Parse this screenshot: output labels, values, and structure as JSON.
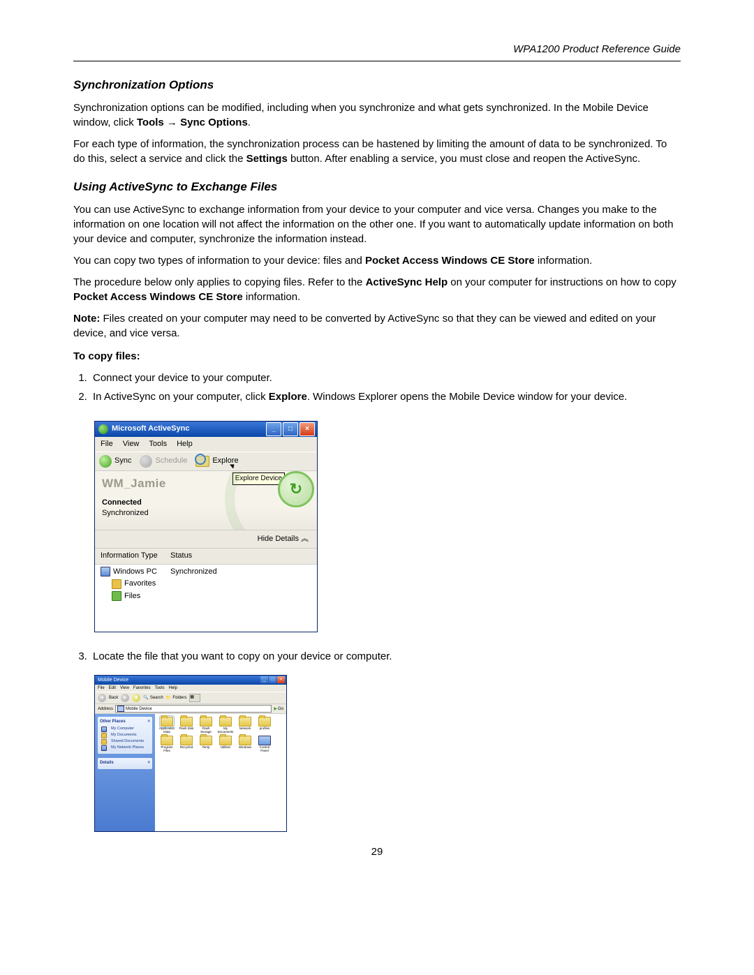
{
  "header": {
    "guide_title": "WPA1200 Product Reference Guide"
  },
  "section1": {
    "heading": "Synchronization Options",
    "para1_a": "Synchronization options can be modified, including when you synchronize and what gets synchronized. In the Mobile Device window, click ",
    "tools_bold": "Tools",
    "arrow": " → ",
    "sync_options_bold": "Sync Options",
    "para1_end": ".",
    "para2_a": "For each type of information, the synchronization process can be hastened by limiting the amount of data to be synchronized. To do this, select a service and click the ",
    "settings_bold": "Settings",
    "para2_b": " button. After enabling a service, you must close and reopen the ActiveSync."
  },
  "section2": {
    "heading": "Using ActiveSync to Exchange Files",
    "para1": "You can use ActiveSync to exchange information from your device to your computer and vice versa. Changes you make to the information on one location will not affect the information on the other one. If you want to automatically update information on both your device and computer, synchronize the information instead.",
    "para2_a": "You can copy two types of information to your device: files and ",
    "pocket_bold": "Pocket Access Windows CE Store",
    "para2_b": " information.",
    "para3_a": "The procedure below only applies to copying files. Refer to the ",
    "ashelp_bold": "ActiveSync Help",
    "para3_b": " on your computer for instructions on how to copy ",
    "pocket_bold2": "Pocket Access Windows CE Store",
    "para3_c": " information.",
    "note_label": "Note:",
    "note_text": " Files created on your computer may need to be converted by ActiveSync so that they can be viewed and edited on your device, and vice versa.",
    "to_copy": "To copy files:",
    "step1": "Connect your device to your computer.",
    "step2_a": "In ActiveSync on your computer, click ",
    "step2_bold": "Explore",
    "step2_b": ". Windows Explorer opens the Mobile Device window for your device.",
    "step3": "Locate the file that you want to copy on your device or computer."
  },
  "activesync": {
    "title": "Microsoft ActiveSync",
    "menu": {
      "file": "File",
      "view": "View",
      "tools": "Tools",
      "help": "Help"
    },
    "toolbar": {
      "sync": "Sync",
      "schedule": "Schedule",
      "explore": "Explore"
    },
    "device_name": "WM_Jamie",
    "tooltip": "Explore Device",
    "connected": "Connected",
    "synchronized": "Synchronized",
    "hide_details": "Hide Details ",
    "hide_chevron": "︽",
    "col_info": "Information Type",
    "col_status": "Status",
    "row_pc": "Windows PC",
    "row_pc_status": "Synchronized",
    "row_fav": "Favorites",
    "row_files": "Files"
  },
  "explorer": {
    "title": "Mobile Device",
    "menu": {
      "file": "File",
      "edit": "Edit",
      "view": "View",
      "favorites": "Favorites",
      "tools": "Tools",
      "help": "Help"
    },
    "toolbar": {
      "back": "Back",
      "search": "Search",
      "folders": "Folders"
    },
    "address_label": "Address",
    "address_value": "Mobile Device",
    "go": "Go",
    "tasks": {
      "panel1_head": "Other Places",
      "panel1_items": [
        "My Computer",
        "My Documents",
        "Shared Documents",
        "My Network Places"
      ],
      "panel2_head": "Details"
    },
    "items": [
      "Application Data",
      "Flash Disk",
      "Flash Storage",
      "My Documents",
      "Network",
      "profiles",
      "Program Files",
      "Recycled",
      "Temp",
      "Utilities",
      "Windows",
      "Control Panel"
    ]
  },
  "page_number": "29"
}
